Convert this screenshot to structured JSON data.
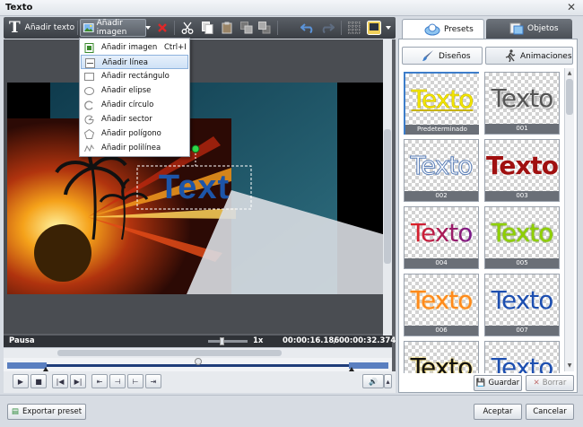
{
  "window": {
    "title": "Texto",
    "close_glyph": "✕"
  },
  "toolbar": {
    "add_text_label": "Añadir texto",
    "add_image_label": "Añadir imagen",
    "icons": [
      "text-tool-icon",
      "image-tool-icon",
      "dropdown-arrow-icon",
      "delete-icon",
      "cut-icon",
      "copy-icon",
      "paste-icon",
      "bring-front-icon",
      "send-back-icon",
      "undo-icon",
      "redo-icon",
      "grid-icon",
      "color-icon"
    ]
  },
  "menu": {
    "items": [
      {
        "label": "Añadir imagen",
        "shortcut": "Ctrl+I",
        "icon": "image-icon"
      },
      {
        "label": "Añadir línea",
        "shortcut": "",
        "icon": "line-icon"
      },
      {
        "label": "Añadir rectángulo",
        "shortcut": "",
        "icon": "rectangle-icon"
      },
      {
        "label": "Añadir elipse",
        "shortcut": "",
        "icon": "ellipse-icon"
      },
      {
        "label": "Añadir círculo",
        "shortcut": "",
        "icon": "circle-icon"
      },
      {
        "label": "Añadir sector",
        "shortcut": "",
        "icon": "sector-icon"
      },
      {
        "label": "Añadir polígono",
        "shortcut": "",
        "icon": "polygon-icon"
      },
      {
        "label": "Añadir polilínea",
        "shortcut": "",
        "icon": "polyline-icon"
      }
    ],
    "highlighted_index": 1
  },
  "canvas": {
    "text": "Text"
  },
  "status": {
    "state": "Pausa",
    "speed": "1x",
    "current": "00:00:16.186",
    "separator": "/",
    "total": "00:00:32.374",
    "zoom_level": 0.35
  },
  "tabs": {
    "presets": "Presets",
    "objetos": "Objetos"
  },
  "subtabs": {
    "disenos": "Diseños",
    "animaciones": "Animaciones"
  },
  "presets": [
    {
      "caption": "Predeterminado",
      "text": "Texto",
      "fill": "#f2e600",
      "stroke": "#c8b400",
      "style": "underline",
      "selected": true
    },
    {
      "caption": "001",
      "text": "Texto",
      "fill": "#555555",
      "stroke": "#ffffff",
      "style": "shadow",
      "selected": false
    },
    {
      "caption": "002",
      "text": "Texto",
      "fill": "#ffffff",
      "stroke": "#5b7fb8",
      "style": "outline",
      "selected": false
    },
    {
      "caption": "003",
      "text": "Texto",
      "fill": "#a01010",
      "stroke": "#ffffff",
      "style": "bold",
      "selected": false
    },
    {
      "caption": "004",
      "text": "Texto",
      "fill": "#7a1a8c",
      "stroke": "#e02020",
      "style": "gradient",
      "selected": false
    },
    {
      "caption": "005",
      "text": "Texto",
      "fill": "#8fd000",
      "stroke": "#4a7a00",
      "style": "plain",
      "selected": false
    },
    {
      "caption": "006",
      "text": "Texto",
      "fill": "#ff8a1a",
      "stroke": "#ffcf80",
      "style": "plain",
      "selected": false
    },
    {
      "caption": "007",
      "text": "Texto",
      "fill": "#1d4fb0",
      "stroke": "#ffffff",
      "style": "plain",
      "selected": false
    },
    {
      "caption": "",
      "text": "Texto",
      "fill": "#111111",
      "stroke": "#f2c200",
      "style": "plain",
      "selected": false
    },
    {
      "caption": "",
      "text": "Texto",
      "fill": "#1d4fb0",
      "stroke": "#ffffff",
      "style": "plain",
      "selected": false
    }
  ],
  "right_buttons": {
    "save": "Guardar",
    "delete": "Borrar"
  },
  "bottom": {
    "export": "Exportar preset",
    "accept": "Aceptar",
    "cancel": "Cancelar"
  },
  "colors": {
    "toolbar_dark": "#3a3e44",
    "accent": "#3d7dca",
    "highlight": "#cfe2f6"
  }
}
